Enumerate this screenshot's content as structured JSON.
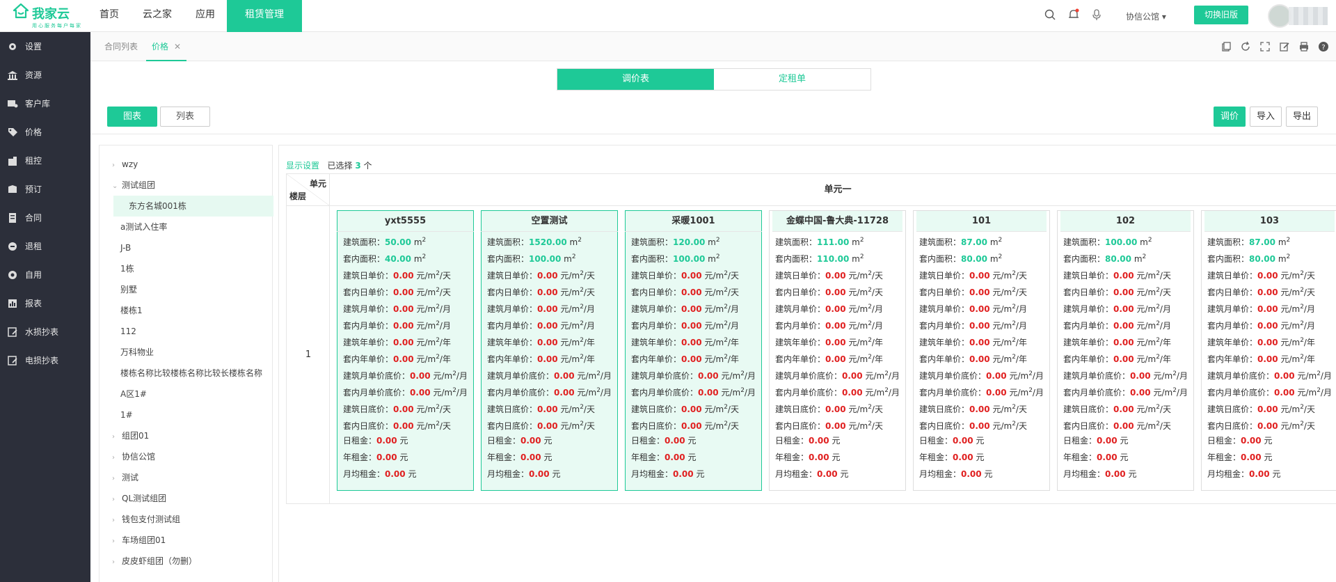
{
  "brand": {
    "name": "我家云",
    "slogan": "用心服务每户每家",
    "accent": "#1ec997"
  },
  "topnav": [
    "首页",
    "云之家",
    "应用",
    "租赁管理"
  ],
  "topnav_active": "租赁管理",
  "topbar": {
    "org": "协信公馆",
    "switch_label": "切换旧版"
  },
  "sidebar": [
    {
      "label": "设置",
      "icon": "gear-icon"
    },
    {
      "label": "资源",
      "icon": "bank-icon"
    },
    {
      "label": "客户库",
      "icon": "customer-icon"
    },
    {
      "label": "价格",
      "icon": "tag-icon"
    },
    {
      "label": "租控",
      "icon": "building-icon"
    },
    {
      "label": "预订",
      "icon": "booking-icon"
    },
    {
      "label": "合同",
      "icon": "contract-icon"
    },
    {
      "label": "退租",
      "icon": "checkout-icon"
    },
    {
      "label": "自用",
      "icon": "selfuse-icon"
    },
    {
      "label": "报表",
      "icon": "report-icon"
    },
    {
      "label": "水损抄表",
      "icon": "water-meter-icon"
    },
    {
      "label": "电损抄表",
      "icon": "electric-meter-icon"
    }
  ],
  "tabs": [
    {
      "label": "合同列表"
    },
    {
      "label": "价格",
      "active": true
    }
  ],
  "segment": [
    "调价表",
    "定租单"
  ],
  "view_toggle": [
    "图表",
    "列表"
  ],
  "actions": [
    "调价",
    "导入",
    "导出"
  ],
  "tree": [
    {
      "label": "wzy",
      "arrow": "›",
      "depth": 0
    },
    {
      "label": "测试组团",
      "arrow": "⌄",
      "depth": 0
    },
    {
      "label": "东方名城001栋",
      "depth": 1,
      "selected": true
    },
    {
      "label": "a测试入住率",
      "depth": 1
    },
    {
      "label": "J-B",
      "depth": 1
    },
    {
      "label": "1栋",
      "depth": 1
    },
    {
      "label": "别墅",
      "depth": 1
    },
    {
      "label": "楼栋1",
      "depth": 1
    },
    {
      "label": "112",
      "depth": 1
    },
    {
      "label": "万科物业",
      "depth": 1
    },
    {
      "label": "楼栋名称比较楼栋名称比较长楼栋名称",
      "depth": 1
    },
    {
      "label": "A区1#",
      "depth": 1
    },
    {
      "label": "1#",
      "depth": 1
    },
    {
      "label": "组团01",
      "arrow": "›",
      "depth": 0
    },
    {
      "label": "协信公馆",
      "arrow": "›",
      "depth": 0
    },
    {
      "label": "测试",
      "arrow": "›",
      "depth": 0
    },
    {
      "label": "QL测试组团",
      "arrow": "›",
      "depth": 0
    },
    {
      "label": "钱包支付测试组",
      "arrow": "›",
      "depth": 0
    },
    {
      "label": "车场组团01",
      "arrow": "›",
      "depth": 0
    },
    {
      "label": "皮皮虾组团（勿删）",
      "arrow": "›",
      "depth": 0
    }
  ],
  "grid": {
    "display_link": "显示设置",
    "selected_prefix": "已选择",
    "selected_count": "3",
    "selected_suffix": "个",
    "corner_unit": "单元",
    "corner_floor": "楼层",
    "unit_name": "单元一",
    "floor": "1",
    "rows": [
      {
        "label": "建筑面积：",
        "key": "build_area",
        "unit": "m",
        "sup": "2",
        "color": "g"
      },
      {
        "label": "套内面积：",
        "key": "inner_area",
        "unit": "m",
        "sup": "2",
        "color": "g"
      },
      {
        "label": "建筑日单价：",
        "val": "0.00",
        "unit": "元/m",
        "sup": "2",
        "tail": "/天",
        "color": "r"
      },
      {
        "label": "套内日单价：",
        "val": "0.00",
        "unit": "元/m",
        "sup": "2",
        "tail": "/天",
        "color": "r"
      },
      {
        "label": "建筑月单价：",
        "val": "0.00",
        "unit": "元/m",
        "sup": "2",
        "tail": "/月",
        "color": "r"
      },
      {
        "label": "套内月单价：",
        "val": "0.00",
        "unit": "元/m",
        "sup": "2",
        "tail": "/月",
        "color": "r"
      },
      {
        "label": "建筑年单价：",
        "val": "0.00",
        "unit": "元/m",
        "sup": "2",
        "tail": "/年",
        "color": "r"
      },
      {
        "label": "套内年单价：",
        "val": "0.00",
        "unit": "元/m",
        "sup": "2",
        "tail": "/年",
        "color": "r"
      },
      {
        "label": "建筑月单价底价：",
        "val": "0.00",
        "unit": "元/m",
        "sup": "2",
        "tail": "/月",
        "color": "r"
      },
      {
        "label": "套内月单价底价：",
        "val": "0.00",
        "unit": "元/m",
        "sup": "2",
        "tail": "/月",
        "color": "r"
      },
      {
        "label": "建筑日底价：",
        "val": "0.00",
        "unit": "元/m",
        "sup": "2",
        "tail": "/天",
        "color": "r"
      },
      {
        "label": "套内日底价：",
        "val": "0.00",
        "unit": "元/m",
        "sup": "2",
        "tail": "/天",
        "color": "r"
      },
      {
        "label": "日租金：",
        "val": "0.00",
        "unit": "元",
        "color": "r"
      },
      {
        "label": "年租金：",
        "val": "0.00",
        "unit": "元",
        "color": "r"
      },
      {
        "label": "月均租金：",
        "val": "0.00",
        "unit": "元",
        "color": "r"
      }
    ],
    "rooms": [
      {
        "name": "yxt5555",
        "build_area": "50.00",
        "inner_area": "40.00",
        "selected": true
      },
      {
        "name": "空置测试",
        "build_area": "1520.00",
        "inner_area": "100.00",
        "selected": true
      },
      {
        "name": "采暖1001",
        "build_area": "120.00",
        "inner_area": "100.00",
        "selected": true
      },
      {
        "name": "金蝶中国-鲁大典-11728",
        "build_area": "111.00",
        "inner_area": "110.00",
        "selected": false
      },
      {
        "name": "101",
        "build_area": "87.00",
        "inner_area": "80.00",
        "selected": false
      },
      {
        "name": "102",
        "build_area": "100.00",
        "inner_area": "80.00",
        "selected": false
      },
      {
        "name": "103",
        "build_area": "87.00",
        "inner_area": "80.00",
        "selected": false
      }
    ]
  }
}
